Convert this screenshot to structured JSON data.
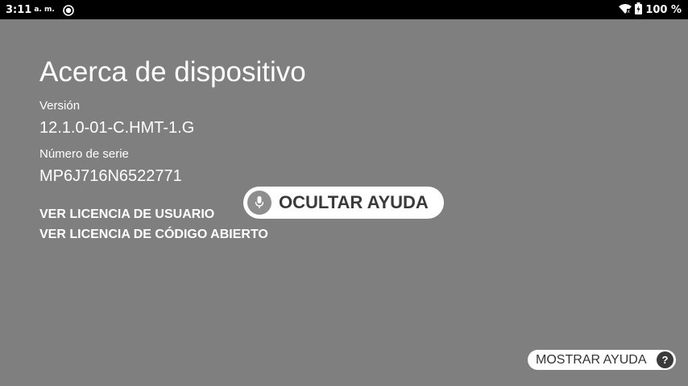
{
  "status_bar": {
    "time": "3:11",
    "ampm": "a. m.",
    "battery_percent": "100 %",
    "icons": [
      "notification-icon",
      "wifi-icon",
      "battery-icon"
    ]
  },
  "page": {
    "title": "Acerca de dispositivo",
    "version_label": "Versión",
    "version_value": "12.1.0-01-C.HMT-1.G",
    "serial_label": "Número de serie",
    "serial_value": "MP6J716N6522771",
    "user_license_link": "VER LICENCIA DE USUARIO",
    "open_source_license_link": "VER LICENCIA DE CÓDIGO ABIERTO"
  },
  "voice_help": {
    "hide_label": "OCULTAR AYUDA",
    "show_label": "MOSTRAR AYUDA",
    "question_mark": "?"
  },
  "colors": {
    "background": "#7f7f7f",
    "status_bar": "#000000",
    "pill": "#ffffff"
  }
}
